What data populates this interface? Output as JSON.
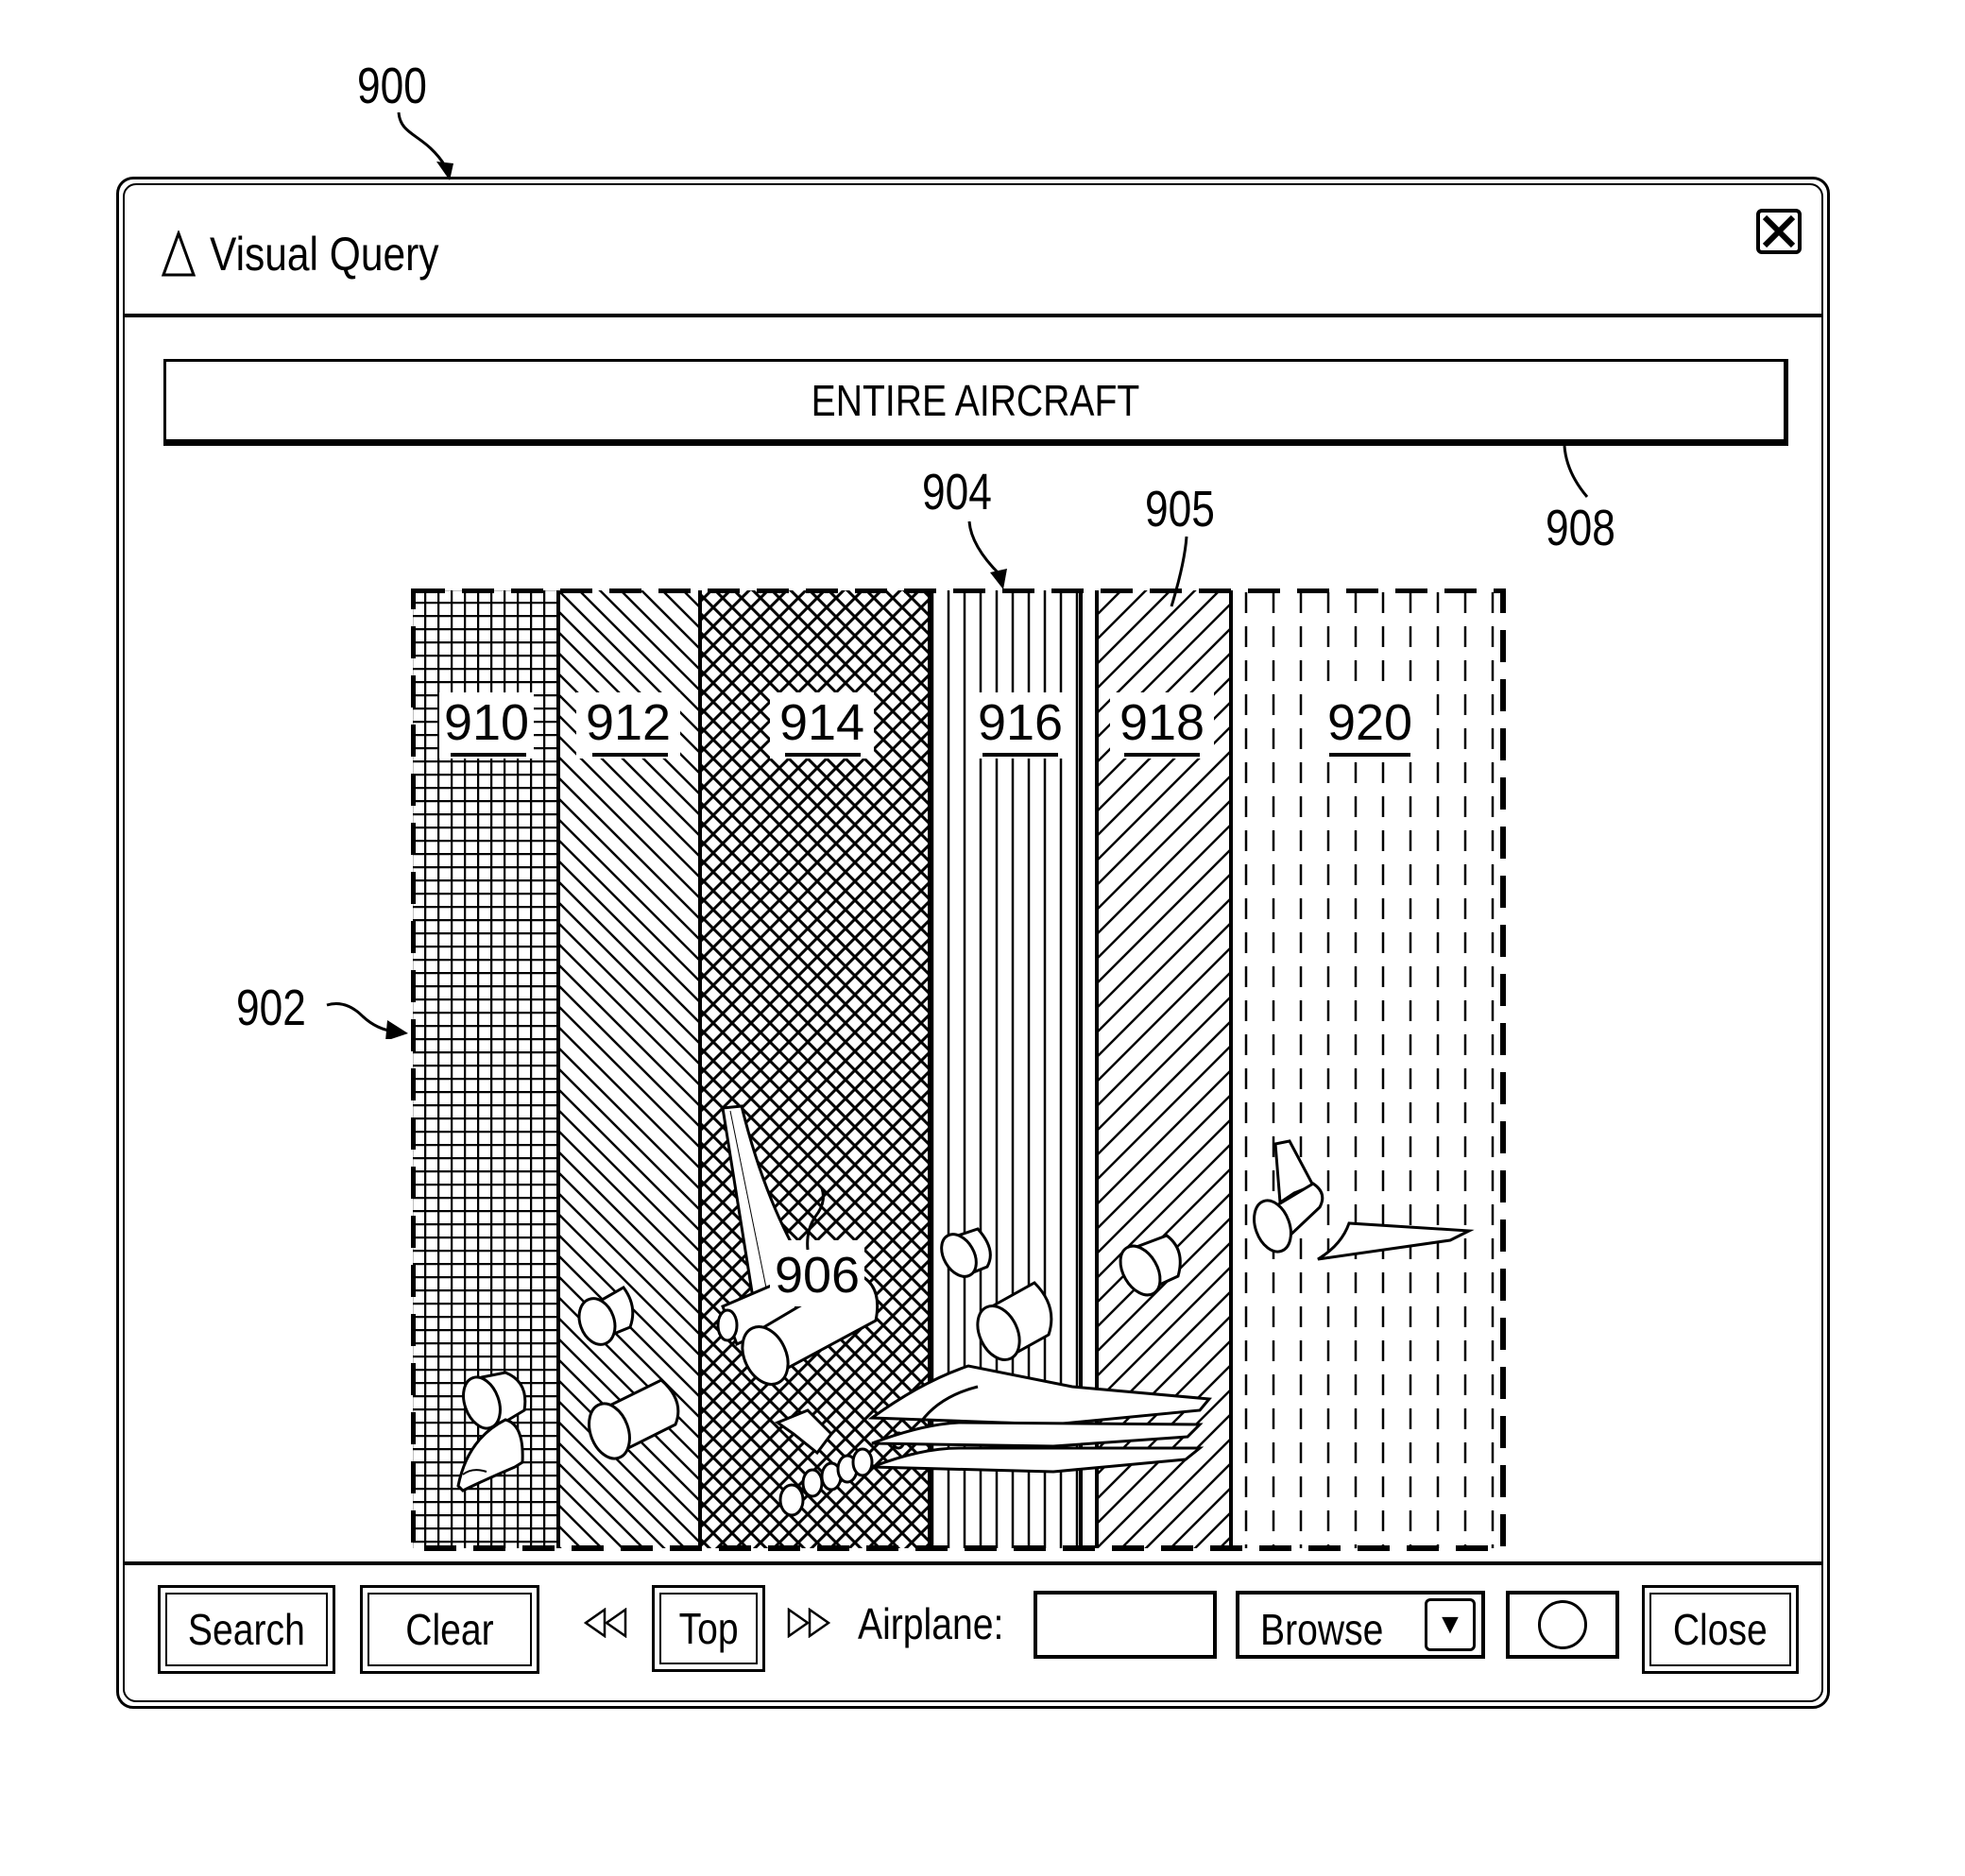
{
  "figure_refs": {
    "window": "900",
    "sector_panel": "902",
    "sector_904": "904",
    "sector_905": "905",
    "part_group": "906",
    "scope_bar": "908"
  },
  "window": {
    "title": "Visual Query",
    "title_icon": "triangle-icon",
    "close_icon": "close-x-icon"
  },
  "scope_bar": {
    "label": "ENTIRE AIRCRAFT"
  },
  "sectors": [
    {
      "id": "910",
      "pattern": "grid"
    },
    {
      "id": "912",
      "pattern": "backslash-hatch"
    },
    {
      "id": "914",
      "pattern": "cross-hatch"
    },
    {
      "id": "916",
      "pattern": "vertical-lines"
    },
    {
      "id": "918",
      "pattern": "forward-slash-hatch"
    },
    {
      "id": "920",
      "pattern": "dashed-vertical"
    }
  ],
  "toolbar": {
    "search_label": "Search",
    "clear_label": "Clear",
    "prev_icon": "rewind-icon",
    "top_label": "Top",
    "next_icon": "fast-forward-icon",
    "airplane_label": "Airplane:",
    "airplane_value": "",
    "browse_value": "Browse",
    "browse_icon": "dropdown-arrow-icon",
    "option_icon": "circle-radio-icon",
    "close_label": "Close"
  }
}
